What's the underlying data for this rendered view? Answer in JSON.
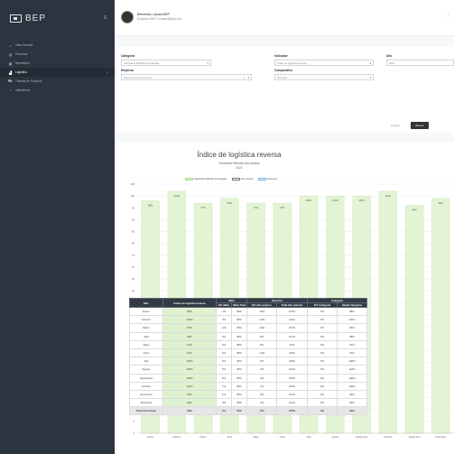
{
  "brand": {
    "name": "BEP"
  },
  "sidebar": {
    "items": [
      {
        "label": "Vista General",
        "icon": "home-icon",
        "active": false
      },
      {
        "label": "Procesos",
        "icon": "list-icon",
        "active": false
      },
      {
        "label": "Inventarios",
        "icon": "box-icon",
        "active": false
      },
      {
        "label": "Logística",
        "icon": "chart-icon",
        "active": true
      },
      {
        "label": "Tránsito de Producto",
        "icon": "truck-icon",
        "active": false
      },
      {
        "label": "Indicadores",
        "icon": "gauge-icon",
        "active": false
      }
    ]
  },
  "header": {
    "user_name": "Bienvenido, Usuario BEP",
    "user_email": "Empresa: BEP / usuario@bep.com",
    "menu_icon": "grid-icon"
  },
  "filters": {
    "categoria_label": "Categoría",
    "categoria_value": "Fabricante Bebidas Azucaradas",
    "indicador_label": "Indicador",
    "indicador_value": "Índice de logística reversa",
    "ano_label": "Año",
    "ano_value": "2021",
    "empresa_label": "Empresa",
    "empresa_value": "Seleccione una empresa",
    "comparativo_label": "Comparativo",
    "comparativo_value": "Mensual",
    "limpiar_label": "Limpiar",
    "buscar_label": "Buscar"
  },
  "chart_data": {
    "type": "bar",
    "title": "Índice de logística reversa",
    "subtitle": "Fabricante Bebidas Azucaradas",
    "year": "2021",
    "legend": [
      "Fabricante Bebidas Azucaradas",
      "Año anterior",
      "Categoría"
    ],
    "categories": [
      "Enero",
      "Febrero",
      "Marzo",
      "Abril",
      "Mayo",
      "Junio",
      "Julio",
      "Agosto",
      "Septiembre",
      "Octubre",
      "Noviembre",
      "Diciembre"
    ],
    "values": [
      98,
      102,
      97,
      99,
      97,
      97,
      100,
      100,
      100,
      102,
      96,
      99
    ],
    "value_labels": [
      "98%",
      "102%",
      "97%",
      "99%",
      "97%",
      "97%",
      "100%",
      "100%",
      "100%",
      "102%",
      "96%",
      "99%"
    ],
    "y_ticks": [
      "105",
      "100",
      "95",
      "90",
      "85",
      "80",
      "75",
      "70",
      "65",
      "60",
      "55",
      "50",
      "45",
      "40",
      "35",
      "30",
      "25",
      "20",
      "15",
      "10",
      "5",
      "0"
    ],
    "ylim": [
      0,
      105
    ],
    "bar_color": "#e2f4d3",
    "bar_border": "#c9e6b4"
  },
  "table": {
    "headers": {
      "mes": "Mes",
      "indice": "Índice de logística reversa",
      "meta": "Meta",
      "historico": "Histórico",
      "categoria": "Categoría",
      "dif_meta": "Dif. Meta",
      "meta_total": "Meta Total",
      "dif_ano": "Dif. Año anterior",
      "total_ano": "Total Año anterior",
      "dif_categoria": "Dif. Categoría",
      "media_categoria": "Media Categoría"
    },
    "rows": [
      [
        "Enero",
        "98%",
        "-1%",
        "95%",
        "-10%",
        "104%",
        "0%",
        "98%"
      ],
      [
        "Febrero",
        "102%",
        "4%",
        "95%",
        "-12%",
        "114%",
        "0%",
        "102%"
      ],
      [
        "Marzo",
        "97%",
        "-2%",
        "95%",
        "-10%",
        "107%",
        "0%",
        "96%"
      ],
      [
        "Abril",
        "99%",
        "3%",
        "95%",
        "-8%",
        "107%",
        "0%",
        "98%"
      ],
      [
        "Mayo",
        "97%",
        "2%",
        "95%",
        "0%",
        "97%",
        "0%",
        "97%"
      ],
      [
        "Junio",
        "97%",
        "2%",
        "95%",
        "-14%",
        "111%",
        "0%",
        "97%"
      ],
      [
        "Julio",
        "100%",
        "5%",
        "95%",
        "-5%",
        "105%",
        "0%",
        "100%"
      ],
      [
        "Agosto",
        "100%",
        "5%",
        "95%",
        "-3%",
        "103%",
        "0%",
        "110%"
      ],
      [
        "Septiembre",
        "100%",
        "5%",
        "95%",
        "-3%",
        "103%",
        "0%",
        "100%"
      ],
      [
        "Octubre",
        "102%",
        "7%",
        "95%",
        "-1%",
        "103%",
        "0%",
        "102%"
      ],
      [
        "Noviembre",
        "96%",
        "1%",
        "95%",
        "-5%",
        "101%",
        "0%",
        "96%"
      ],
      [
        "Diciembre",
        "99%",
        "4%",
        "95%",
        "-2%",
        "101%",
        "0%",
        "99%"
      ]
    ],
    "total": [
      "Total Acumulado",
      "99%",
      "4%",
      "95%",
      "-6%",
      "105%",
      "0%",
      "99%"
    ]
  }
}
